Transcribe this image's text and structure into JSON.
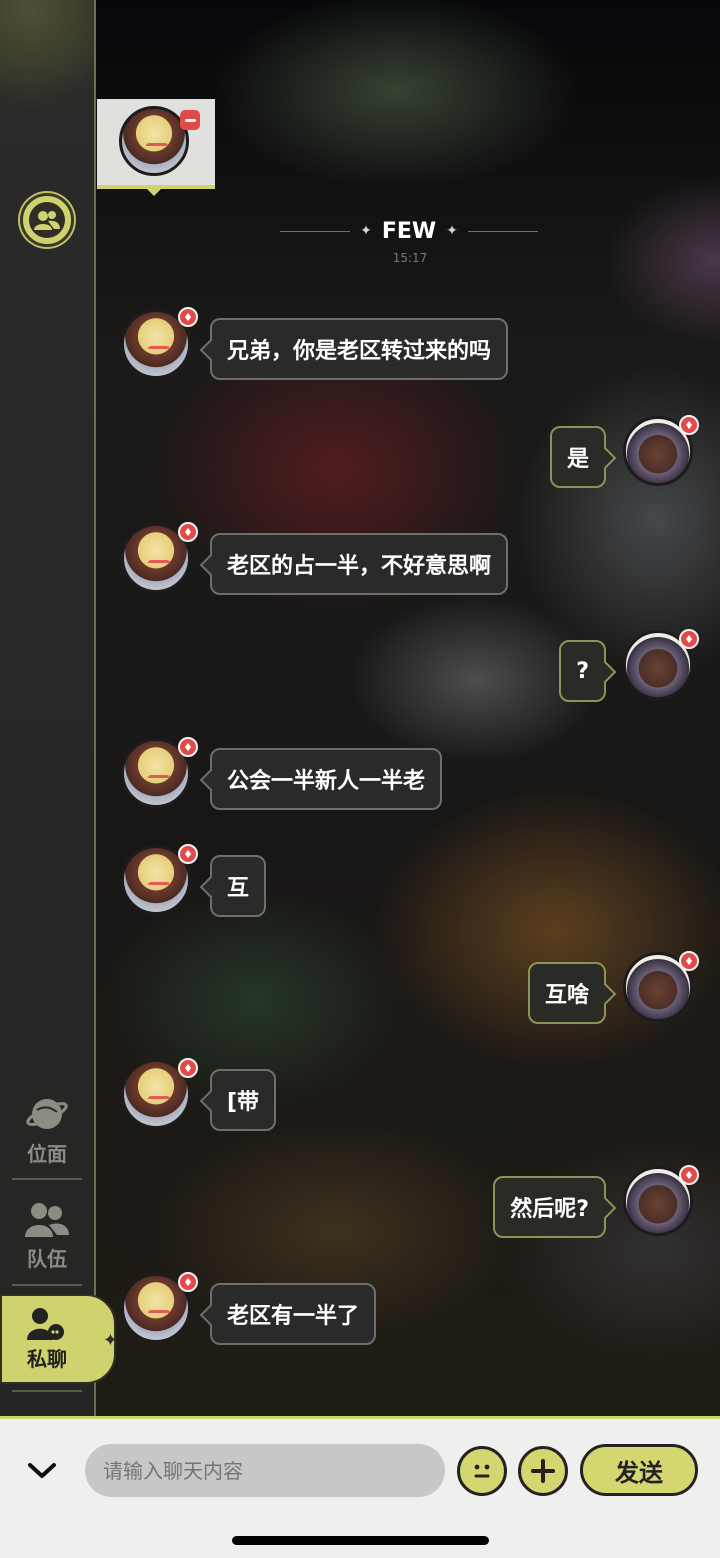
{
  "sidebar": {
    "items": [
      {
        "label": "位面",
        "icon": "planet-icon"
      },
      {
        "label": "队伍",
        "icon": "team-icon"
      },
      {
        "label": "私聊",
        "icon": "private-chat-icon",
        "active": true
      }
    ],
    "contacts_icon": "contacts-icon"
  },
  "chat": {
    "title": "FEW",
    "time": "15:17",
    "messages": [
      {
        "side": "in",
        "text": "兄弟，你是老区转过来的吗"
      },
      {
        "side": "out",
        "text": "是"
      },
      {
        "side": "in",
        "text": "老区的占一半，不好意思啊"
      },
      {
        "side": "out",
        "text": "?"
      },
      {
        "side": "in",
        "text": "公会一半新人一半老"
      },
      {
        "side": "in",
        "text": "互"
      },
      {
        "side": "out",
        "text": "互啥"
      },
      {
        "side": "in",
        "text": "[带"
      },
      {
        "side": "out",
        "text": "然后呢?"
      },
      {
        "side": "in",
        "text": "老区有一半了"
      }
    ]
  },
  "composer": {
    "placeholder": "请输入聊天内容",
    "send_label": "发送"
  },
  "colors": {
    "accent": "#cfd36e",
    "badge": "#e24a4a",
    "sidebar_bg": "#252624",
    "bubble_in_border": "#6e6e6c",
    "bubble_out_border": "#8f9157"
  }
}
